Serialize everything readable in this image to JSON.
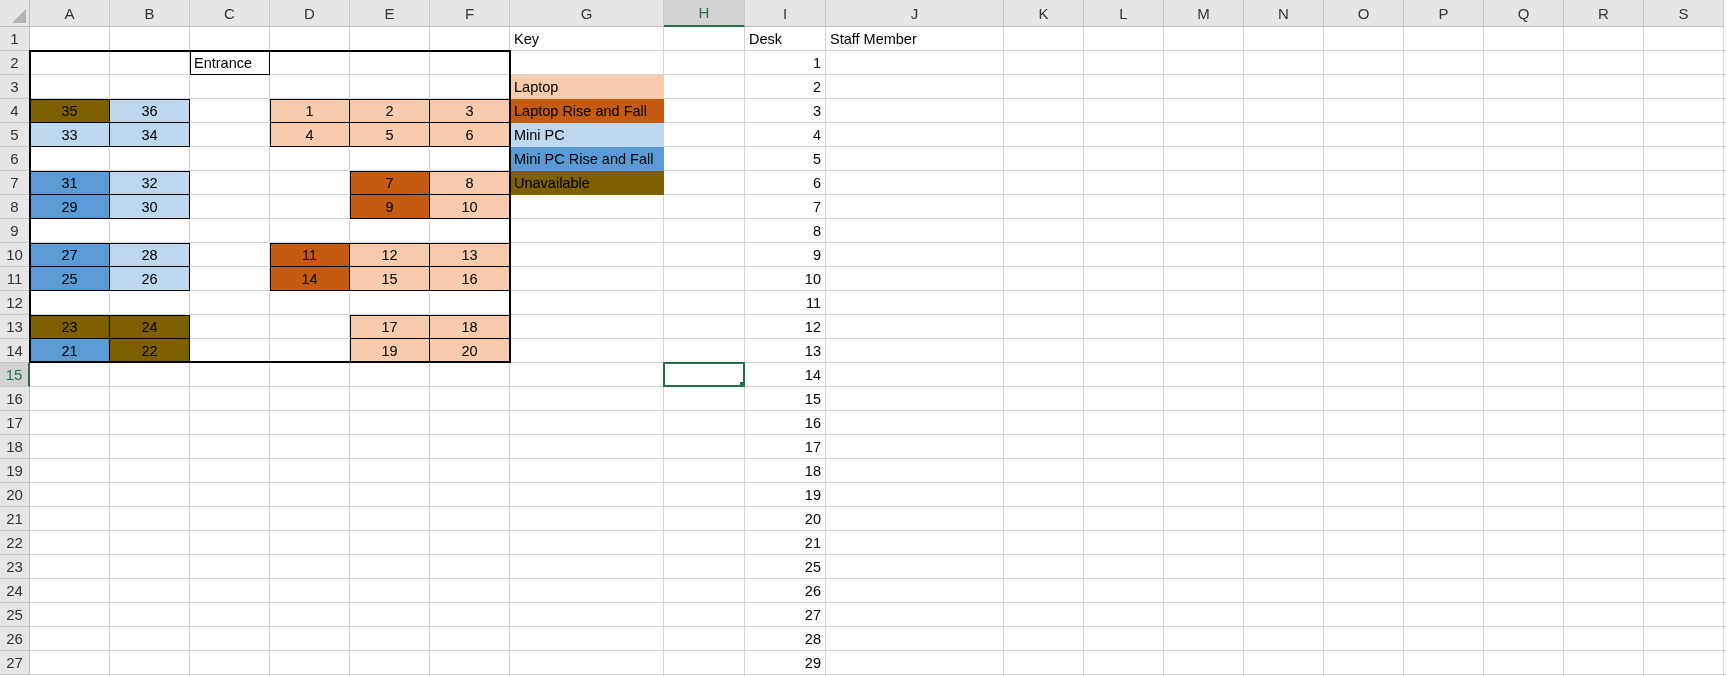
{
  "sheet": {
    "columns": [
      {
        "label": "A",
        "selected": false
      },
      {
        "label": "B",
        "selected": false
      },
      {
        "label": "C",
        "selected": false
      },
      {
        "label": "D",
        "selected": false
      },
      {
        "label": "E",
        "selected": false
      },
      {
        "label": "F",
        "selected": false
      },
      {
        "label": "G",
        "selected": false
      },
      {
        "label": "H",
        "selected": true
      },
      {
        "label": "I",
        "selected": false
      },
      {
        "label": "J",
        "selected": false
      },
      {
        "label": "K",
        "selected": false
      },
      {
        "label": "L",
        "selected": false
      },
      {
        "label": "M",
        "selected": false
      },
      {
        "label": "N",
        "selected": false
      },
      {
        "label": "O",
        "selected": false
      },
      {
        "label": "P",
        "selected": false
      },
      {
        "label": "Q",
        "selected": false
      },
      {
        "label": "R",
        "selected": false
      },
      {
        "label": "S",
        "selected": false
      }
    ],
    "rows": [
      {
        "label": "1",
        "selected": false,
        "cells": [
          {},
          {},
          {},
          {},
          {},
          {},
          {
            "kind": "label",
            "text": "Key"
          },
          {},
          {
            "kind": "label",
            "text": "Desk"
          },
          {
            "kind": "label",
            "text": "Staff Member"
          }
        ]
      },
      {
        "label": "2",
        "selected": false,
        "cells": [
          {},
          {},
          {
            "kind": "sign",
            "text": "Entrance"
          },
          {},
          {},
          {},
          {},
          {},
          {
            "kind": "number",
            "text": "1"
          }
        ]
      },
      {
        "label": "3",
        "selected": false,
        "cells": [
          {},
          {},
          {},
          {},
          {},
          {},
          {
            "kind": "key",
            "text": "Laptop",
            "color": "#f8cbad"
          },
          {},
          {
            "kind": "number",
            "text": "2"
          }
        ]
      },
      {
        "label": "4",
        "selected": false,
        "cells": [
          {
            "kind": "desk",
            "text": "35",
            "color": "#7f6000"
          },
          {
            "kind": "desk",
            "text": "36",
            "color": "#bdd7ee"
          },
          {},
          {
            "kind": "desk",
            "text": "1",
            "color": "#f8cbad"
          },
          {
            "kind": "desk",
            "text": "2",
            "color": "#f8cbad"
          },
          {
            "kind": "desk",
            "text": "3",
            "color": "#f8cbad"
          },
          {
            "kind": "key",
            "text": "Laptop Rise and Fall",
            "color": "#c55a11"
          },
          {},
          {
            "kind": "number",
            "text": "3"
          }
        ]
      },
      {
        "label": "5",
        "selected": false,
        "cells": [
          {
            "kind": "desk",
            "text": "33",
            "color": "#bdd7ee"
          },
          {
            "kind": "desk",
            "text": "34",
            "color": "#bdd7ee"
          },
          {},
          {
            "kind": "desk",
            "text": "4",
            "color": "#f8cbad"
          },
          {
            "kind": "desk",
            "text": "5",
            "color": "#f8cbad"
          },
          {
            "kind": "desk",
            "text": "6",
            "color": "#f8cbad"
          },
          {
            "kind": "key",
            "text": "Mini PC",
            "color": "#bdd7ee"
          },
          {},
          {
            "kind": "number",
            "text": "4"
          }
        ]
      },
      {
        "label": "6",
        "selected": false,
        "cells": [
          {},
          {},
          {},
          {},
          {},
          {},
          {
            "kind": "key",
            "text": "Mini PC Rise and Fall",
            "color": "#5b9bd5"
          },
          {},
          {
            "kind": "number",
            "text": "5"
          }
        ]
      },
      {
        "label": "7",
        "selected": false,
        "cells": [
          {
            "kind": "desk",
            "text": "31",
            "color": "#5b9bd5"
          },
          {
            "kind": "desk",
            "text": "32",
            "color": "#bdd7ee"
          },
          {},
          {},
          {
            "kind": "desk",
            "text": "7",
            "color": "#c55a11"
          },
          {
            "kind": "desk",
            "text": "8",
            "color": "#f8cbad"
          },
          {
            "kind": "key",
            "text": "Unavailable",
            "color": "#7f6000"
          },
          {},
          {
            "kind": "number",
            "text": "6"
          }
        ]
      },
      {
        "label": "8",
        "selected": false,
        "cells": [
          {
            "kind": "desk",
            "text": "29",
            "color": "#5b9bd5"
          },
          {
            "kind": "desk",
            "text": "30",
            "color": "#bdd7ee"
          },
          {},
          {},
          {
            "kind": "desk",
            "text": "9",
            "color": "#c55a11"
          },
          {
            "kind": "desk",
            "text": "10",
            "color": "#f8cbad"
          },
          {},
          {},
          {
            "kind": "number",
            "text": "7"
          }
        ]
      },
      {
        "label": "9",
        "selected": false,
        "cells": [
          {},
          {},
          {},
          {},
          {},
          {},
          {},
          {},
          {
            "kind": "number",
            "text": "8"
          }
        ]
      },
      {
        "label": "10",
        "selected": false,
        "cells": [
          {
            "kind": "desk",
            "text": "27",
            "color": "#5b9bd5"
          },
          {
            "kind": "desk",
            "text": "28",
            "color": "#bdd7ee"
          },
          {},
          {
            "kind": "desk",
            "text": "11",
            "color": "#c55a11"
          },
          {
            "kind": "desk",
            "text": "12",
            "color": "#f8cbad"
          },
          {
            "kind": "desk",
            "text": "13",
            "color": "#f8cbad"
          },
          {},
          {},
          {
            "kind": "number",
            "text": "9"
          }
        ]
      },
      {
        "label": "11",
        "selected": false,
        "cells": [
          {
            "kind": "desk",
            "text": "25",
            "color": "#5b9bd5"
          },
          {
            "kind": "desk",
            "text": "26",
            "color": "#bdd7ee"
          },
          {},
          {
            "kind": "desk",
            "text": "14",
            "color": "#c55a11"
          },
          {
            "kind": "desk",
            "text": "15",
            "color": "#f8cbad"
          },
          {
            "kind": "desk",
            "text": "16",
            "color": "#f8cbad"
          },
          {},
          {},
          {
            "kind": "number",
            "text": "10"
          }
        ]
      },
      {
        "label": "12",
        "selected": false,
        "cells": [
          {},
          {},
          {},
          {},
          {},
          {},
          {},
          {},
          {
            "kind": "number",
            "text": "11"
          }
        ]
      },
      {
        "label": "13",
        "selected": false,
        "cells": [
          {
            "kind": "desk",
            "text": "23",
            "color": "#7f6000"
          },
          {
            "kind": "desk",
            "text": "24",
            "color": "#7f6000"
          },
          {},
          {},
          {
            "kind": "desk",
            "text": "17",
            "color": "#f8cbad"
          },
          {
            "kind": "desk",
            "text": "18",
            "color": "#f8cbad"
          },
          {},
          {},
          {
            "kind": "number",
            "text": "12"
          }
        ]
      },
      {
        "label": "14",
        "selected": false,
        "cells": [
          {
            "kind": "desk",
            "text": "21",
            "color": "#5b9bd5"
          },
          {
            "kind": "desk",
            "text": "22",
            "color": "#7f6000"
          },
          {},
          {},
          {
            "kind": "desk",
            "text": "19",
            "color": "#f8cbad"
          },
          {
            "kind": "desk",
            "text": "20",
            "color": "#f8cbad"
          },
          {},
          {},
          {
            "kind": "number",
            "text": "13"
          }
        ]
      },
      {
        "label": "15",
        "selected": true,
        "cells": [
          {},
          {},
          {},
          {},
          {},
          {},
          {},
          {},
          {
            "kind": "number",
            "text": "14"
          }
        ]
      },
      {
        "label": "16",
        "selected": false,
        "cells": [
          {},
          {},
          {},
          {},
          {},
          {},
          {},
          {},
          {
            "kind": "number",
            "text": "15"
          }
        ]
      },
      {
        "label": "17",
        "selected": false,
        "cells": [
          {},
          {},
          {},
          {},
          {},
          {},
          {},
          {},
          {
            "kind": "number",
            "text": "16"
          }
        ]
      },
      {
        "label": "18",
        "selected": false,
        "cells": [
          {},
          {},
          {},
          {},
          {},
          {},
          {},
          {},
          {
            "kind": "number",
            "text": "17"
          }
        ]
      },
      {
        "label": "19",
        "selected": false,
        "cells": [
          {},
          {},
          {},
          {},
          {},
          {},
          {},
          {},
          {
            "kind": "number",
            "text": "18"
          }
        ]
      },
      {
        "label": "20",
        "selected": false,
        "cells": [
          {},
          {},
          {},
          {},
          {},
          {},
          {},
          {},
          {
            "kind": "number",
            "text": "19"
          }
        ]
      },
      {
        "label": "21",
        "selected": false,
        "cells": [
          {},
          {},
          {},
          {},
          {},
          {},
          {},
          {},
          {
            "kind": "number",
            "text": "20"
          }
        ]
      },
      {
        "label": "22",
        "selected": false,
        "cells": [
          {},
          {},
          {},
          {},
          {},
          {},
          {},
          {},
          {
            "kind": "number",
            "text": "21"
          }
        ]
      },
      {
        "label": "23",
        "selected": false,
        "cells": [
          {},
          {},
          {},
          {},
          {},
          {},
          {},
          {},
          {
            "kind": "number",
            "text": "25"
          }
        ]
      },
      {
        "label": "24",
        "selected": false,
        "cells": [
          {},
          {},
          {},
          {},
          {},
          {},
          {},
          {},
          {
            "kind": "number",
            "text": "26"
          }
        ]
      },
      {
        "label": "25",
        "selected": false,
        "cells": [
          {},
          {},
          {},
          {},
          {},
          {},
          {},
          {},
          {
            "kind": "number",
            "text": "27"
          }
        ]
      },
      {
        "label": "26",
        "selected": false,
        "cells": [
          {},
          {},
          {},
          {},
          {},
          {},
          {},
          {},
          {
            "kind": "number",
            "text": "28"
          }
        ]
      },
      {
        "label": "27",
        "selected": false,
        "cells": [
          {},
          {},
          {},
          {},
          {},
          {},
          {},
          {},
          {
            "kind": "number",
            "text": "29"
          }
        ]
      }
    ]
  }
}
